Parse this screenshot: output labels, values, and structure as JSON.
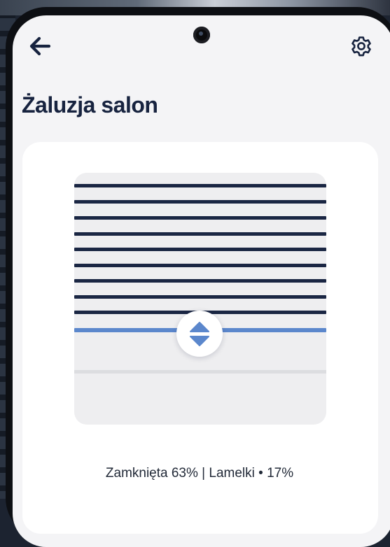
{
  "header": {
    "back_icon": "arrow-left-icon",
    "settings_icon": "gear-icon"
  },
  "page": {
    "title": "Żaluzja salon"
  },
  "blind": {
    "closed_percent": 63,
    "slats_percent": 17,
    "slat_count": 10
  },
  "status": {
    "text": "Zamknięta 63% | Lamelki • 17%"
  },
  "colors": {
    "slat": "#1a2643",
    "active_slat": "#5b87cc",
    "title": "#17233f",
    "screen_bg": "#f4f4f6",
    "card_bg": "#ffffff"
  }
}
